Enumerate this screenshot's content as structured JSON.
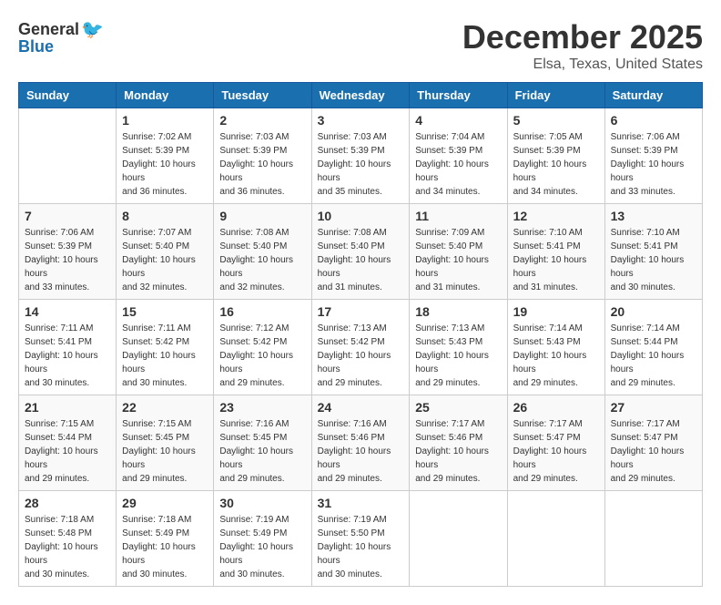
{
  "logo": {
    "text_general": "General",
    "text_blue": "Blue"
  },
  "title": {
    "month": "December 2025",
    "location": "Elsa, Texas, United States"
  },
  "weekdays": [
    "Sunday",
    "Monday",
    "Tuesday",
    "Wednesday",
    "Thursday",
    "Friday",
    "Saturday"
  ],
  "weeks": [
    [
      {
        "day": "",
        "sunrise": "",
        "sunset": "",
        "daylight": ""
      },
      {
        "day": "1",
        "sunrise": "Sunrise: 7:02 AM",
        "sunset": "Sunset: 5:39 PM",
        "daylight": "Daylight: 10 hours and 36 minutes."
      },
      {
        "day": "2",
        "sunrise": "Sunrise: 7:03 AM",
        "sunset": "Sunset: 5:39 PM",
        "daylight": "Daylight: 10 hours and 36 minutes."
      },
      {
        "day": "3",
        "sunrise": "Sunrise: 7:03 AM",
        "sunset": "Sunset: 5:39 PM",
        "daylight": "Daylight: 10 hours and 35 minutes."
      },
      {
        "day": "4",
        "sunrise": "Sunrise: 7:04 AM",
        "sunset": "Sunset: 5:39 PM",
        "daylight": "Daylight: 10 hours and 34 minutes."
      },
      {
        "day": "5",
        "sunrise": "Sunrise: 7:05 AM",
        "sunset": "Sunset: 5:39 PM",
        "daylight": "Daylight: 10 hours and 34 minutes."
      },
      {
        "day": "6",
        "sunrise": "Sunrise: 7:06 AM",
        "sunset": "Sunset: 5:39 PM",
        "daylight": "Daylight: 10 hours and 33 minutes."
      }
    ],
    [
      {
        "day": "7",
        "sunrise": "Sunrise: 7:06 AM",
        "sunset": "Sunset: 5:39 PM",
        "daylight": "Daylight: 10 hours and 33 minutes."
      },
      {
        "day": "8",
        "sunrise": "Sunrise: 7:07 AM",
        "sunset": "Sunset: 5:40 PM",
        "daylight": "Daylight: 10 hours and 32 minutes."
      },
      {
        "day": "9",
        "sunrise": "Sunrise: 7:08 AM",
        "sunset": "Sunset: 5:40 PM",
        "daylight": "Daylight: 10 hours and 32 minutes."
      },
      {
        "day": "10",
        "sunrise": "Sunrise: 7:08 AM",
        "sunset": "Sunset: 5:40 PM",
        "daylight": "Daylight: 10 hours and 31 minutes."
      },
      {
        "day": "11",
        "sunrise": "Sunrise: 7:09 AM",
        "sunset": "Sunset: 5:40 PM",
        "daylight": "Daylight: 10 hours and 31 minutes."
      },
      {
        "day": "12",
        "sunrise": "Sunrise: 7:10 AM",
        "sunset": "Sunset: 5:41 PM",
        "daylight": "Daylight: 10 hours and 31 minutes."
      },
      {
        "day": "13",
        "sunrise": "Sunrise: 7:10 AM",
        "sunset": "Sunset: 5:41 PM",
        "daylight": "Daylight: 10 hours and 30 minutes."
      }
    ],
    [
      {
        "day": "14",
        "sunrise": "Sunrise: 7:11 AM",
        "sunset": "Sunset: 5:41 PM",
        "daylight": "Daylight: 10 hours and 30 minutes."
      },
      {
        "day": "15",
        "sunrise": "Sunrise: 7:11 AM",
        "sunset": "Sunset: 5:42 PM",
        "daylight": "Daylight: 10 hours and 30 minutes."
      },
      {
        "day": "16",
        "sunrise": "Sunrise: 7:12 AM",
        "sunset": "Sunset: 5:42 PM",
        "daylight": "Daylight: 10 hours and 29 minutes."
      },
      {
        "day": "17",
        "sunrise": "Sunrise: 7:13 AM",
        "sunset": "Sunset: 5:42 PM",
        "daylight": "Daylight: 10 hours and 29 minutes."
      },
      {
        "day": "18",
        "sunrise": "Sunrise: 7:13 AM",
        "sunset": "Sunset: 5:43 PM",
        "daylight": "Daylight: 10 hours and 29 minutes."
      },
      {
        "day": "19",
        "sunrise": "Sunrise: 7:14 AM",
        "sunset": "Sunset: 5:43 PM",
        "daylight": "Daylight: 10 hours and 29 minutes."
      },
      {
        "day": "20",
        "sunrise": "Sunrise: 7:14 AM",
        "sunset": "Sunset: 5:44 PM",
        "daylight": "Daylight: 10 hours and 29 minutes."
      }
    ],
    [
      {
        "day": "21",
        "sunrise": "Sunrise: 7:15 AM",
        "sunset": "Sunset: 5:44 PM",
        "daylight": "Daylight: 10 hours and 29 minutes."
      },
      {
        "day": "22",
        "sunrise": "Sunrise: 7:15 AM",
        "sunset": "Sunset: 5:45 PM",
        "daylight": "Daylight: 10 hours and 29 minutes."
      },
      {
        "day": "23",
        "sunrise": "Sunrise: 7:16 AM",
        "sunset": "Sunset: 5:45 PM",
        "daylight": "Daylight: 10 hours and 29 minutes."
      },
      {
        "day": "24",
        "sunrise": "Sunrise: 7:16 AM",
        "sunset": "Sunset: 5:46 PM",
        "daylight": "Daylight: 10 hours and 29 minutes."
      },
      {
        "day": "25",
        "sunrise": "Sunrise: 7:17 AM",
        "sunset": "Sunset: 5:46 PM",
        "daylight": "Daylight: 10 hours and 29 minutes."
      },
      {
        "day": "26",
        "sunrise": "Sunrise: 7:17 AM",
        "sunset": "Sunset: 5:47 PM",
        "daylight": "Daylight: 10 hours and 29 minutes."
      },
      {
        "day": "27",
        "sunrise": "Sunrise: 7:17 AM",
        "sunset": "Sunset: 5:47 PM",
        "daylight": "Daylight: 10 hours and 29 minutes."
      }
    ],
    [
      {
        "day": "28",
        "sunrise": "Sunrise: 7:18 AM",
        "sunset": "Sunset: 5:48 PM",
        "daylight": "Daylight: 10 hours and 30 minutes."
      },
      {
        "day": "29",
        "sunrise": "Sunrise: 7:18 AM",
        "sunset": "Sunset: 5:49 PM",
        "daylight": "Daylight: 10 hours and 30 minutes."
      },
      {
        "day": "30",
        "sunrise": "Sunrise: 7:19 AM",
        "sunset": "Sunset: 5:49 PM",
        "daylight": "Daylight: 10 hours and 30 minutes."
      },
      {
        "day": "31",
        "sunrise": "Sunrise: 7:19 AM",
        "sunset": "Sunset: 5:50 PM",
        "daylight": "Daylight: 10 hours and 30 minutes."
      },
      {
        "day": "",
        "sunrise": "",
        "sunset": "",
        "daylight": ""
      },
      {
        "day": "",
        "sunrise": "",
        "sunset": "",
        "daylight": ""
      },
      {
        "day": "",
        "sunrise": "",
        "sunset": "",
        "daylight": ""
      }
    ]
  ]
}
